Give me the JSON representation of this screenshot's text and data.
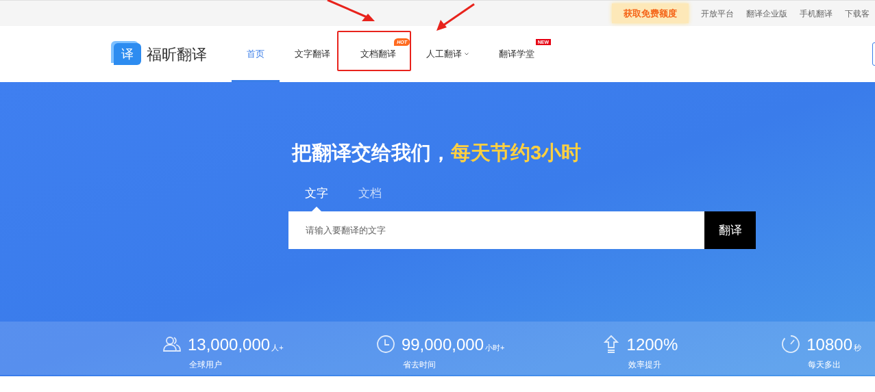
{
  "top_bar": {
    "promo": "获取免费额度",
    "links": [
      "开放平台",
      "翻译企业版",
      "手机翻译",
      "下载客"
    ]
  },
  "nav": {
    "logo_mark": "译",
    "logo_text": "福昕翻译",
    "items": [
      {
        "label": "首页",
        "selected": true,
        "has_menu": false,
        "highlighted": false
      },
      {
        "label": "文字翻译",
        "selected": false,
        "has_menu": false,
        "highlighted": false
      },
      {
        "label": "文档翻译",
        "selected": false,
        "has_menu": false,
        "highlighted": true,
        "badge": {
          "kind": "hot",
          "text": "HOT"
        }
      },
      {
        "label": "人工翻译",
        "selected": false,
        "has_menu": true,
        "highlighted": false
      },
      {
        "label": "翻译学堂",
        "selected": false,
        "has_menu": false,
        "highlighted": false,
        "badge": {
          "kind": "new",
          "text": "NEW"
        }
      }
    ]
  },
  "hero": {
    "headline": "把翻译交给我们，",
    "headline_highlight": "每天节约3小时",
    "tabs": [
      {
        "label": "文字",
        "selected": true
      },
      {
        "label": "文档",
        "selected": false
      }
    ],
    "input": {
      "placeholder": "请输入要翻译的文字"
    },
    "button": "翻译"
  },
  "stats": [
    {
      "kind": "users",
      "value": "13,000,000",
      "unit": "人+",
      "label": "全球用户"
    },
    {
      "kind": "clock",
      "value": "99,000,000",
      "unit": "小时+",
      "label": "省去时间"
    },
    {
      "kind": "arrow",
      "value": "1200%",
      "label": "效率提升"
    },
    {
      "kind": "gauge",
      "value": "10800",
      "unit": "秒",
      "label": "每天多出"
    }
  ]
}
